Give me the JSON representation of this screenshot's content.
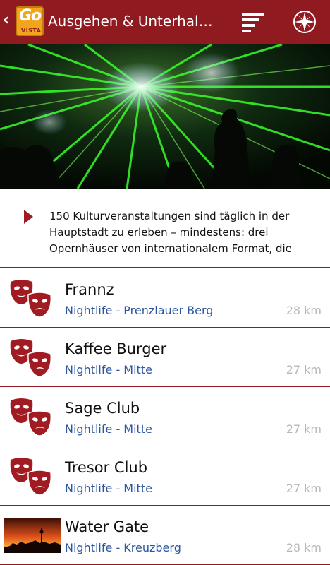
{
  "header": {
    "back_symbol": "‹",
    "logo_go": "Go",
    "logo_vista": "VISTA",
    "title": "Ausgehen & Unterhaltung",
    "menu_icon": "menu-icon",
    "compass_icon": "compass-icon",
    "bar_color": "#8f1a1f"
  },
  "intro": {
    "text": "150 Kulturveranstaltungen sind täglich in der Hauptstadt zu erleben – mindestens: drei Opernhäuser von internationalem Format, die"
  },
  "items": [
    {
      "name": "Frannz",
      "category": "Nightlife - Prenzlauer Berg",
      "distance": "28 km",
      "icon": "theater-masks-icon"
    },
    {
      "name": "Kaffee Burger",
      "category": "Nightlife - Mitte",
      "distance": "27 km",
      "icon": "theater-masks-icon"
    },
    {
      "name": "Sage Club",
      "category": "Nightlife - Mitte",
      "distance": "27 km",
      "icon": "theater-masks-icon"
    },
    {
      "name": "Tresor Club",
      "category": "Nightlife - Mitte",
      "distance": "27 km",
      "icon": "theater-masks-icon"
    },
    {
      "name": "Water Gate",
      "category": "Nightlife - Kreuzberg",
      "distance": "28 km",
      "icon": "sunset-photo"
    }
  ]
}
